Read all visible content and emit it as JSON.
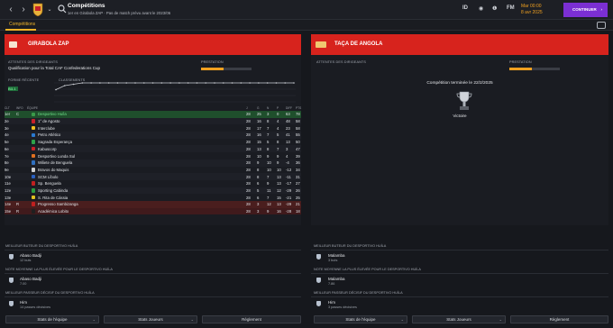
{
  "topbar": {
    "title": "Compétitions",
    "subtitle": "1er en Girabola ZAP · Pas de match prévu avant le 2023/06",
    "date_time": "Mar 00:00",
    "date": "8 avr 2025",
    "continue_label": "CONTINUER",
    "icons": [
      "back-icon",
      "forward-icon",
      "home-icon",
      "search-icon",
      "id-icon",
      "globe-icon",
      "info-icon",
      "fm-icon",
      "settings-icon"
    ],
    "id_label": "ID",
    "fm_label": "FM"
  },
  "tabs": [
    {
      "label": "Compétitions",
      "active": true
    }
  ],
  "left": {
    "competition": "GIRABOLA ZAP",
    "expectations_label": "ATTENTES DES DIRIGEANTS",
    "expectations_value": "Qualification pour la Total CAF Confederations Cup",
    "performance_label": "PRESTATION",
    "performance_fraction": 0.45,
    "form_label": "FORME RÉCENTE",
    "form_value": "B3.1",
    "rank_label": "CLASSEMENTS",
    "table": {
      "headers": [
        "CLT",
        "INFO",
        "ÉQUIPE",
        "J",
        "G",
        "N",
        "P",
        "DIFF",
        "PTS"
      ],
      "rows": [
        {
          "pos": "1er",
          "info": "C",
          "team": "Desportivo Huíla",
          "j": "28",
          "g": "25",
          "n": "3",
          "p": "0",
          "diff": "63",
          "pts": "78",
          "color": "#3a9a4a"
        },
        {
          "pos": "2e",
          "info": "",
          "team": "1° de Agosto",
          "j": "28",
          "g": "16",
          "n": "8",
          "p": "4",
          "diff": "48",
          "pts": "58",
          "color": "#c8202a"
        },
        {
          "pos": "3e",
          "info": "",
          "team": "Interclube",
          "j": "28",
          "g": "17",
          "n": "7",
          "p": "4",
          "diff": "23",
          "pts": "58",
          "color": "#f0c020"
        },
        {
          "pos": "4e",
          "info": "",
          "team": "Petro Atlético",
          "j": "28",
          "g": "16",
          "n": "7",
          "p": "5",
          "diff": "41",
          "pts": "55",
          "color": "#2a7ad0"
        },
        {
          "pos": "5e",
          "info": "",
          "team": "Sagrada Esperança",
          "j": "28",
          "g": "15",
          "n": "5",
          "p": "8",
          "diff": "13",
          "pts": "50",
          "color": "#2ea24a"
        },
        {
          "pos": "6e",
          "info": "",
          "team": "Kabuscorp",
          "j": "28",
          "g": "13",
          "n": "8",
          "p": "7",
          "diff": "3",
          "pts": "47",
          "color": "#c8202a"
        },
        {
          "pos": "7e",
          "info": "",
          "team": "Desportivo Lunda Sul",
          "j": "28",
          "g": "10",
          "n": "9",
          "p": "9",
          "diff": "4",
          "pts": "39",
          "color": "#e07020"
        },
        {
          "pos": "8e",
          "info": "",
          "team": "Wiliete de Benguela",
          "j": "28",
          "g": "9",
          "n": "10",
          "p": "9",
          "diff": "-4",
          "pts": "36",
          "color": "#3070c0"
        },
        {
          "pos": "9e",
          "info": "",
          "team": "Bravos do Maquis",
          "j": "28",
          "g": "8",
          "n": "10",
          "p": "10",
          "diff": "-12",
          "pts": "34",
          "color": "#d0d0d0"
        },
        {
          "pos": "10e",
          "info": "",
          "team": "SCM Líbolo",
          "j": "28",
          "g": "8",
          "n": "7",
          "p": "13",
          "diff": "-11",
          "pts": "31",
          "color": "#2a60c0"
        },
        {
          "pos": "11e",
          "info": "",
          "team": "Sp. Benguela",
          "j": "28",
          "g": "6",
          "n": "9",
          "p": "13",
          "diff": "-17",
          "pts": "27",
          "color": "#c02020"
        },
        {
          "pos": "12e",
          "info": "",
          "team": "Sporting Cabinda",
          "j": "28",
          "g": "5",
          "n": "11",
          "p": "12",
          "diff": "-29",
          "pts": "26",
          "color": "#2a9a40"
        },
        {
          "pos": "13e",
          "info": "",
          "team": "S. Rita de Cássia",
          "j": "28",
          "g": "6",
          "n": "7",
          "p": "15",
          "diff": "-21",
          "pts": "25",
          "color": "#e0c020"
        },
        {
          "pos": "14e",
          "info": "R",
          "team": "Progresso Sambizanga",
          "j": "28",
          "g": "3",
          "n": "12",
          "p": "13",
          "diff": "-29",
          "pts": "21",
          "color": "#c02020"
        },
        {
          "pos": "15e",
          "info": "R",
          "team": "Académica Lobito",
          "j": "28",
          "g": "3",
          "n": "9",
          "p": "16",
          "diff": "-28",
          "pts": "18",
          "color": "#202020"
        }
      ]
    },
    "position_history": [
      6,
      3,
      2,
      1,
      1,
      1,
      1,
      1,
      1,
      1,
      1,
      1,
      1,
      1,
      1,
      1,
      1,
      1,
      1,
      1,
      1,
      1,
      1,
      1,
      1,
      1,
      1,
      1
    ]
  },
  "right": {
    "competition": "TAÇA DE ANGOLA",
    "expectations_label": "ATTENTES DES DIRIGEANTS",
    "expectations_value": "",
    "performance_label": "PRESTATION",
    "performance_fraction": 0.45,
    "finished_text": "Compétition terminée le 22/2/2025",
    "result": "Victoire"
  },
  "bottom_left": {
    "top_scorer_label": "MEILLEUR BUTEUR DU DESPORTIVO HUÍLA",
    "top_scorer_name": "Abaso Badji",
    "top_scorer_stat": "12 buts",
    "avg_rating_label": "NOTE MOYENNE LA PLUS ÉLEVÉE POUR LE DESPORTIVO HUÍLA",
    "avg_rating_name": "Abaso Badji",
    "avg_rating_stat": "7.00",
    "assists_label": "MEILLEUR PASSEUR DÉCISIF DU DESPORTIVO HUÍLA",
    "assists_name": "Him",
    "assists_stat": "14 passes décisives",
    "buttons": [
      "Stats de l'équipe",
      "Stats Joueurs",
      "Règlement"
    ]
  },
  "bottom_right": {
    "top_scorer_label": "MEILLEUR BUTEUR DU DESPORTIVO HUÍLA",
    "top_scorer_name": "Malamba",
    "top_scorer_stat": "3 buts",
    "avg_rating_label": "NOTE MOYENNE LA PLUS ÉLEVÉE POUR LE DESPORTIVO HUÍLA",
    "avg_rating_name": "Malamba",
    "avg_rating_stat": "7.86",
    "assists_label": "MEILLEUR PASSEUR DÉCISIF DU DESPORTIVO HUÍLA",
    "assists_name": "Him",
    "assists_stat": "3 passes décisives",
    "buttons": [
      "Stats de l'équipe",
      "Stats Joueurs",
      "Règlement"
    ]
  },
  "colors": {
    "accent": "#f0a020",
    "competition_header": "#d7231d",
    "continue": "#7b2fd3"
  }
}
